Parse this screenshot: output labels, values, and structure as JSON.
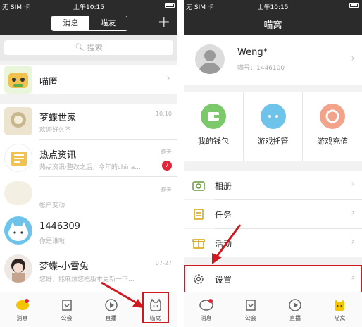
{
  "status": {
    "carrier": "无 SIM 卡",
    "time": "上午10:15"
  },
  "left": {
    "tabs": [
      "消息",
      "喵友"
    ],
    "plus": "+",
    "search_placeholder": "搜索",
    "group": {
      "name": "喵匿"
    },
    "chats": [
      {
        "name": "梦蝶世家",
        "preview": "欢迎好久不",
        "time": "10:10"
      },
      {
        "name": "热点资讯",
        "preview": "热点资讯·整改之后，今年的china...",
        "time": "昨天",
        "badge": "7"
      },
      {
        "name": "",
        "preview": "帐户变动",
        "time": "昨天"
      },
      {
        "name": "1446309",
        "preview": "你是谁啦",
        "time": ""
      },
      {
        "name": "梦蝶-小雪兔",
        "preview": "您好，能麻烦您把版本更新一下...",
        "time": "07-27"
      }
    ]
  },
  "right": {
    "title": "喵窝",
    "user": {
      "name": "Weng*",
      "id": "喵号：1446100"
    },
    "grid": [
      "我的钱包",
      "游戏托管",
      "游戏充值"
    ],
    "menu": [
      "相册",
      "任务",
      "活动"
    ],
    "settings": "设置"
  },
  "tabbar": [
    "消息",
    "公会",
    "直播",
    "喵窝"
  ],
  "colors": {
    "dark": "#2b2b2b",
    "accent_red": "#d0181e",
    "badge": "#e0263a",
    "yellow": "#f5c400"
  }
}
